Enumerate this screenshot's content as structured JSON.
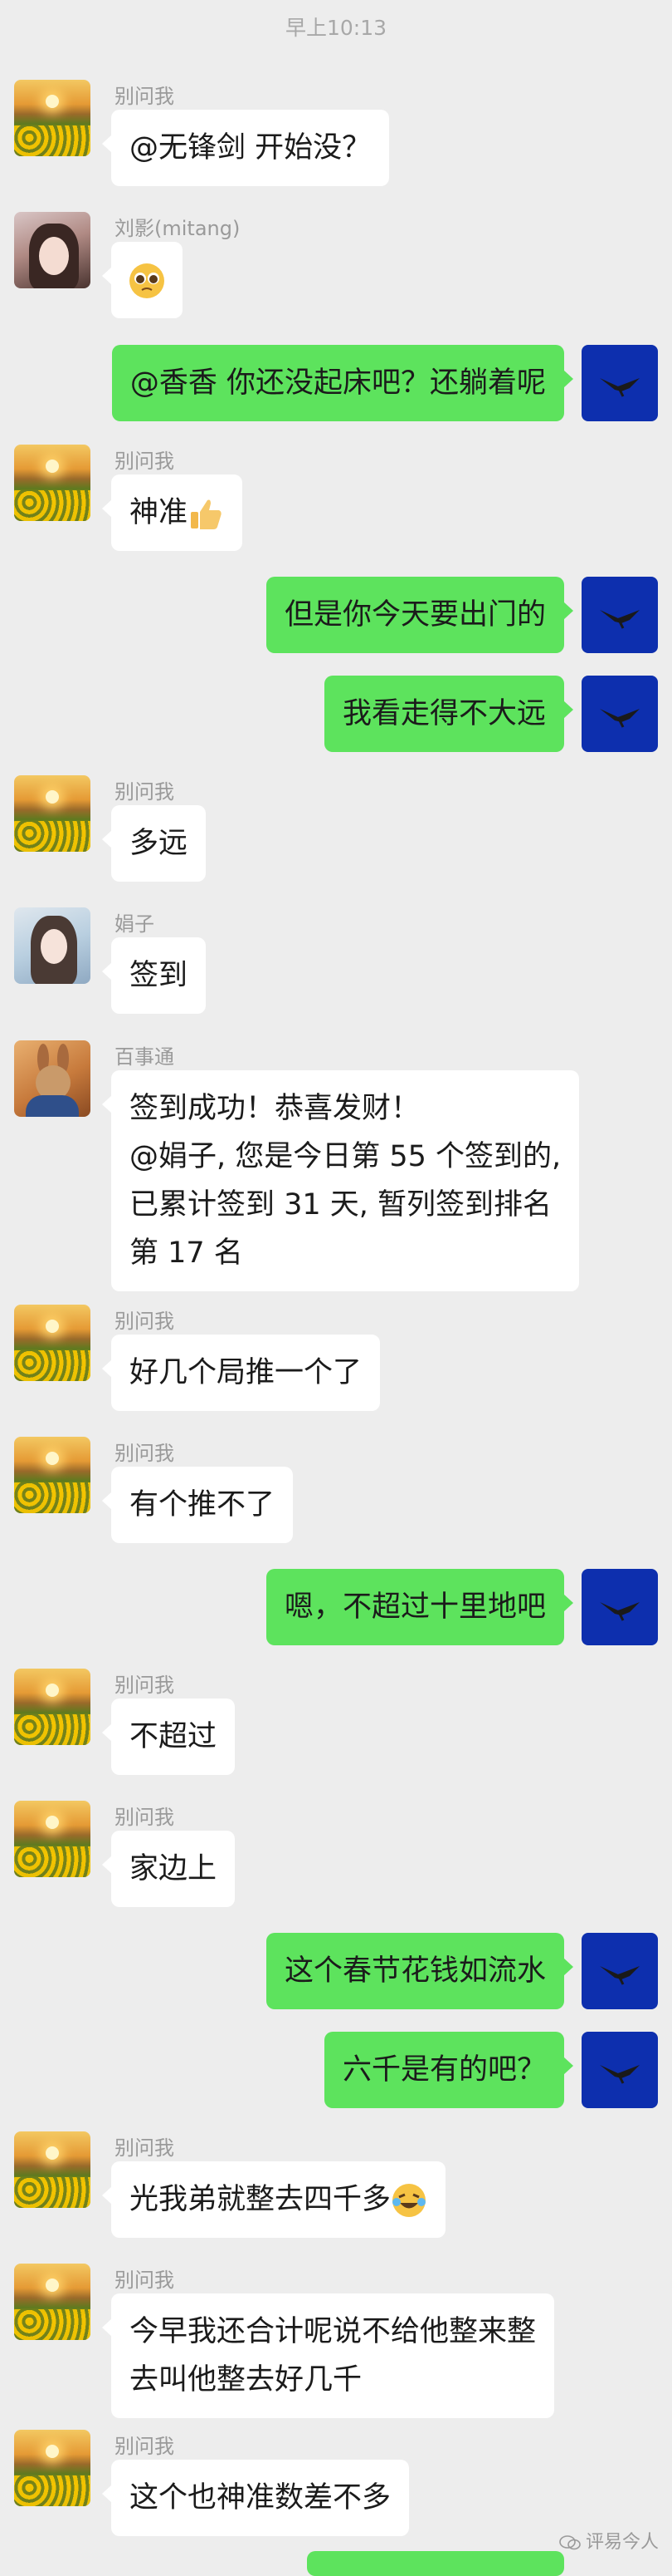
{
  "timestamp": "早上10:13",
  "messages": [
    {
      "side": "left",
      "sender": "别问我",
      "avatar": "sunflower-field",
      "text": "@无锋剑  开始没？"
    },
    {
      "side": "left",
      "sender": "刘影(mitang)",
      "avatar": "girl-portrait",
      "text": "",
      "emoji": "pleading-face-emoji"
    },
    {
      "side": "right",
      "avatar": "eagle",
      "text": "@香香  你还没起床吧？还躺着呢"
    },
    {
      "side": "left",
      "sender": "别问我",
      "avatar": "sunflower-field",
      "text": "神准",
      "emoji": "thumbs-up-emoji"
    },
    {
      "side": "right",
      "avatar": "eagle",
      "text": "但是你今天要出门的"
    },
    {
      "side": "right",
      "avatar": "eagle",
      "text": "我看走得不大远"
    },
    {
      "side": "left",
      "sender": "别问我",
      "avatar": "sunflower-field",
      "text": "多远"
    },
    {
      "side": "left",
      "sender": "娟子",
      "avatar": "girl-portrait-2",
      "text": "签到"
    },
    {
      "side": "left",
      "sender": "百事通",
      "avatar": "rabbit",
      "lines": [
        "签到成功！恭喜发财！",
        "@娟子, 您是今日第 55 个签到的,",
        "已累计签到 31 天, 暂列签到排名",
        "第 17 名"
      ]
    },
    {
      "side": "left",
      "sender": "别问我",
      "avatar": "sunflower-field",
      "text": "好几个局推一个了"
    },
    {
      "side": "left",
      "sender": "别问我",
      "avatar": "sunflower-field",
      "text": "有个推不了"
    },
    {
      "side": "right",
      "avatar": "eagle",
      "text": "嗯，不超过十里地吧"
    },
    {
      "side": "left",
      "sender": "别问我",
      "avatar": "sunflower-field",
      "text": "不超过"
    },
    {
      "side": "left",
      "sender": "别问我",
      "avatar": "sunflower-field",
      "text": "家边上"
    },
    {
      "side": "right",
      "avatar": "eagle",
      "text": "这个春节花钱如流水"
    },
    {
      "side": "right",
      "avatar": "eagle",
      "text": "六千是有的吧？"
    },
    {
      "side": "left",
      "sender": "别问我",
      "avatar": "sunflower-field",
      "text": "光我弟就整去四千多",
      "emoji": "laughing-crying-emoji"
    },
    {
      "side": "left",
      "sender": "别问我",
      "avatar": "sunflower-field",
      "lines": [
        "今早我还合计呢说不给他整来整",
        "去叫他整去好几千"
      ]
    },
    {
      "side": "left",
      "sender": "别问我",
      "avatar": "sunflower-field",
      "text": "这个也神准数差不多"
    }
  ],
  "watermark": "评易今人",
  "colors": {
    "background": "#ededed",
    "bubble_self": "#5de35d",
    "bubble_other": "#ffffff",
    "avatar_self": "#0d2fae"
  }
}
